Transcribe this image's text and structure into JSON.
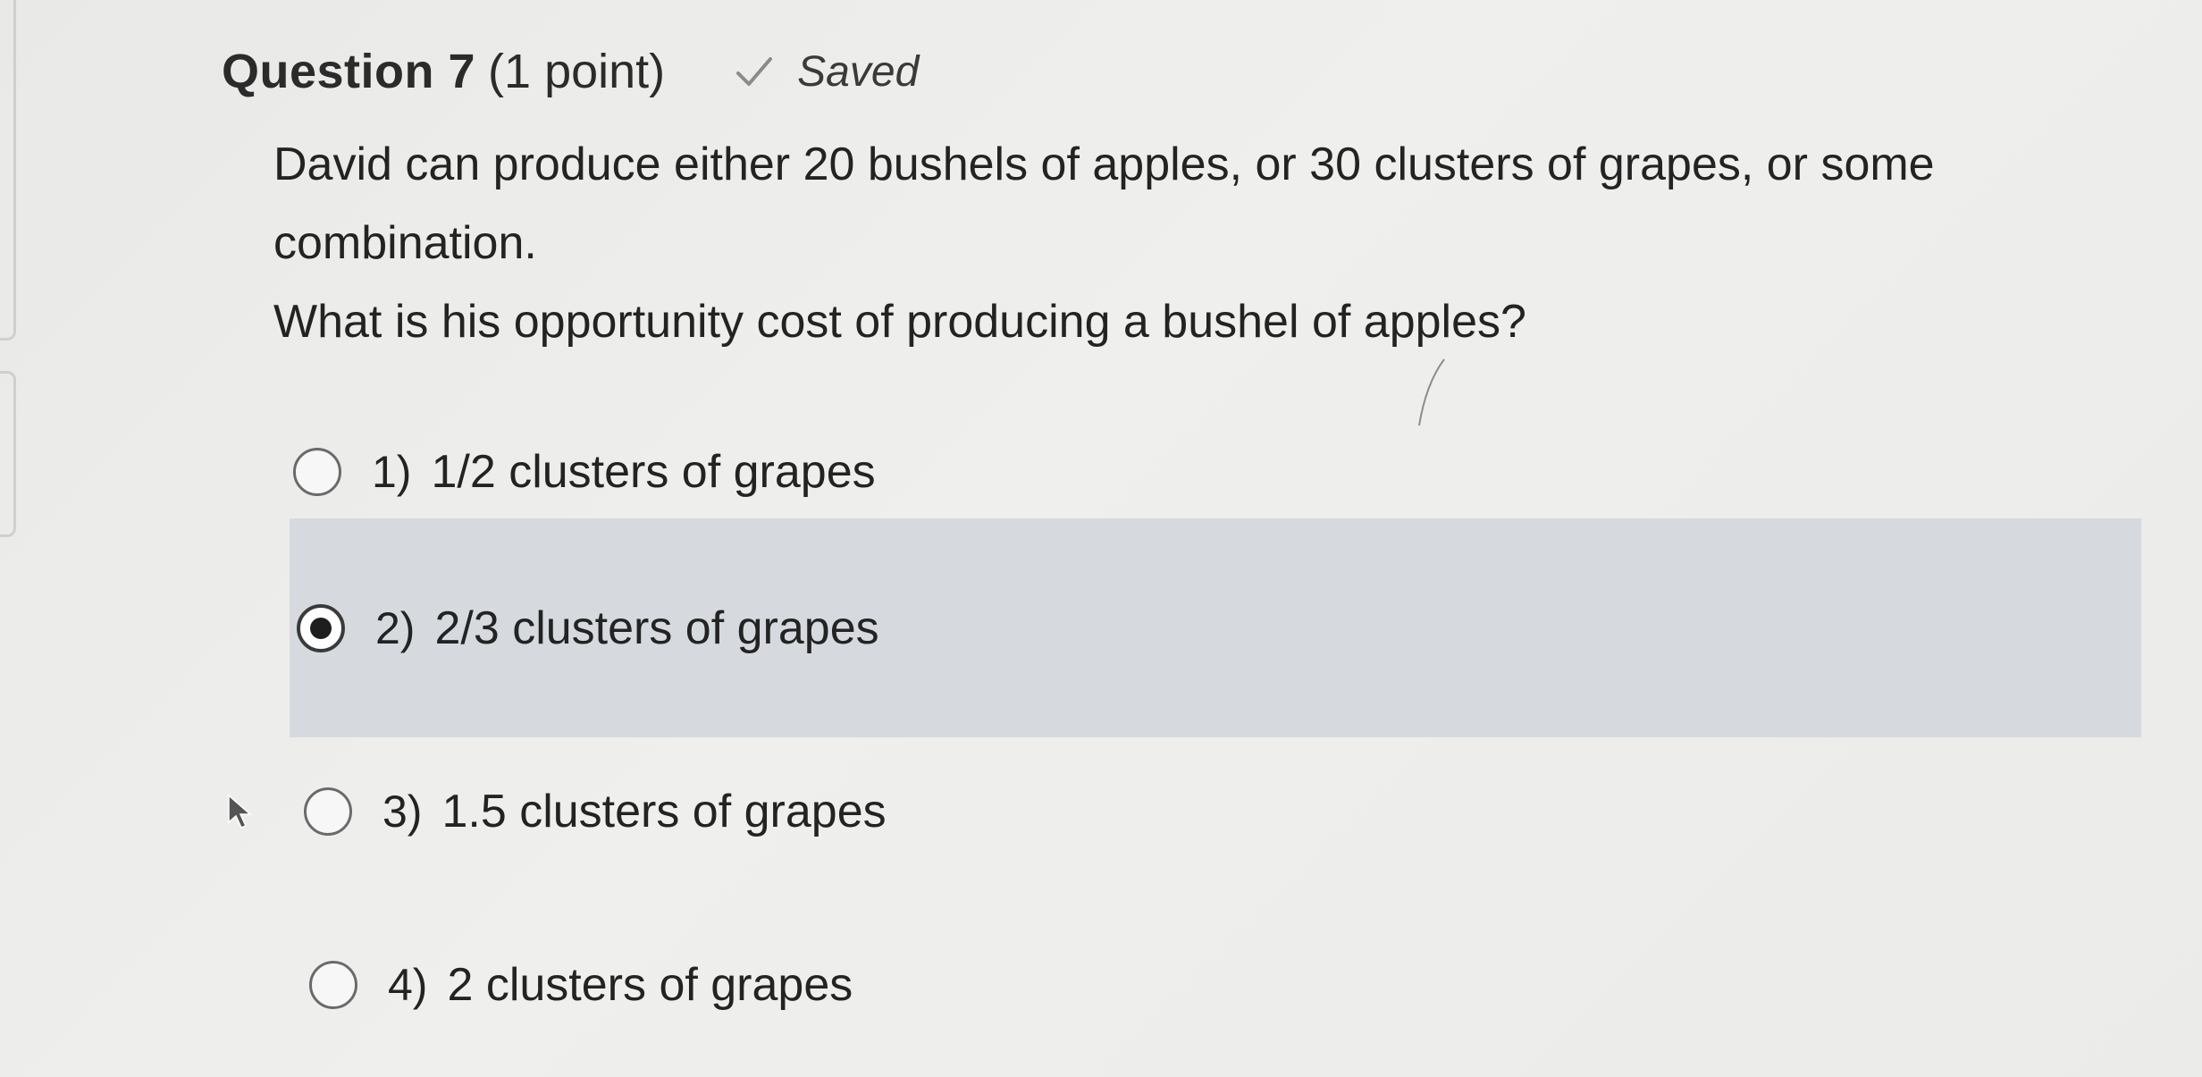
{
  "question": {
    "title": "Question 7",
    "points": "(1 point)",
    "status": "Saved",
    "status_icon": "checkmark-icon"
  },
  "prompt": {
    "line1": "David can produce either 20 bushels of apples, or 30 clusters of grapes, or some",
    "line2": "combination.",
    "line3": "What is his opportunity cost of producing a bushel of apples?"
  },
  "options": [
    {
      "number": "1)",
      "text": "1/2 clusters of grapes",
      "selected": false
    },
    {
      "number": "2)",
      "text": "2/3 clusters of grapes",
      "selected": true
    },
    {
      "number": "3)",
      "text": "1.5 clusters of grapes",
      "selected": false
    },
    {
      "number": "4)",
      "text": "2 clusters of grapes",
      "selected": false
    }
  ],
  "colors": {
    "background": "#ececea",
    "selected_row": "#d6dadf",
    "text": "#232323"
  }
}
